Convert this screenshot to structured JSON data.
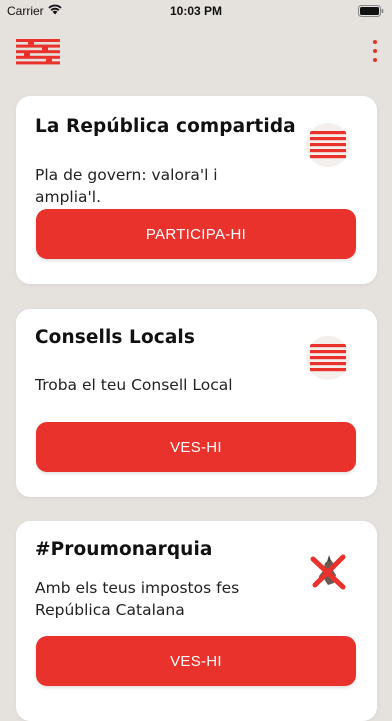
{
  "status_bar": {
    "carrier": "Carrier",
    "time": "10:03 PM"
  },
  "nav": {
    "menu_icon": "brand-logo-menu-icon",
    "more_icon": "more-vertical-icon",
    "accent_color": "#e8322b"
  },
  "cards": [
    {
      "title": "La República compartida",
      "description": "Pla de govern: valora'l i amplia'l.",
      "button_label": "PARTICIPA-HI",
      "icon": "stripes-logo-icon"
    },
    {
      "title": "Consells Locals",
      "description": "Troba el teu Consell Local",
      "button_label": "VES-HI",
      "icon": "stripes-logo-icon"
    },
    {
      "title": "#Proumonarquia",
      "description": "Amb els teus impostos fes República Catalana",
      "button_label": "VES-HI",
      "icon": "crossed-out-monarchy-icon"
    }
  ]
}
